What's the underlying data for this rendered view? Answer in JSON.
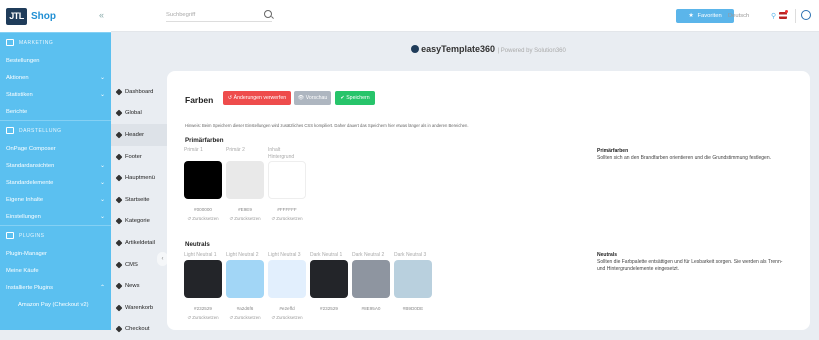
{
  "sidebar": {
    "logo": "JTL",
    "shop": "Shop",
    "collapse": "«",
    "sections": [
      {
        "label": "MARKETING",
        "items": [
          {
            "label": "Bestellungen",
            "caret": ""
          },
          {
            "label": "Aktionen",
            "caret": "⌄"
          },
          {
            "label": "Statistiken",
            "caret": "⌄"
          },
          {
            "label": "Berichte",
            "caret": ""
          }
        ]
      },
      {
        "label": "DARSTELLUNG",
        "items": [
          {
            "label": "OnPage Composer",
            "caret": ""
          },
          {
            "label": "Standardansichten",
            "caret": "⌄"
          },
          {
            "label": "Standardelemente",
            "caret": "⌄"
          },
          {
            "label": "Eigene Inhalte",
            "caret": "⌄"
          },
          {
            "label": "Einstellungen",
            "caret": "⌄"
          }
        ]
      },
      {
        "label": "PLUGINS",
        "items": [
          {
            "label": "Plugin-Manager",
            "caret": ""
          },
          {
            "label": "Meine Käufe",
            "caret": ""
          },
          {
            "label": "Installierte Plugins",
            "caret": "⌃"
          },
          {
            "label": "Amazon Pay (Checkout v2)",
            "caret": ""
          }
        ]
      }
    ]
  },
  "topbar": {
    "search_placeholder": "Suchbegriff",
    "favorites": "Favoriten",
    "language": "Deutsch"
  },
  "subnav": {
    "items": [
      "Dashboard",
      "Global",
      "Header",
      "Footer",
      "Hauptmenü",
      "Startseite",
      "Kategorie",
      "Artikeldetail",
      "CMS",
      "News",
      "Warenkorb",
      "Checkout"
    ],
    "active": 2,
    "toggle": "‹"
  },
  "brand": {
    "name": "easyTemplate360",
    "powered": "Powered by Solution360"
  },
  "card": {
    "title": "Farben",
    "btn_discard": "Änderungen verwerfen",
    "btn_preview": "Vorschau",
    "btn_save": "Speichern",
    "hint": "Hinweis: Beim Speichern dieser Einstellungen wird zusätzliches CSS kompiliert. Daher dauert das Speichern hier etwas länger als in anderen Bereichen.",
    "primary": {
      "title": "Primärfarben",
      "desc_title": "Primärfarben",
      "desc": "Sollten sich an den Brandfarben orientieren und die Grundstimmung festlegen.",
      "swatches": [
        {
          "name": "Primär 1",
          "name2": "",
          "hex": "#000000",
          "reset": "Zurücksetzen"
        },
        {
          "name": "Primär 2",
          "name2": "",
          "hex": "#E9E9",
          "reset": "Zurücksetzen"
        },
        {
          "name": "Inhalt",
          "name2": "Hintergrund",
          "hex": "#FFFFFF",
          "reset": "Zurücksetzen"
        }
      ],
      "colors": [
        "#000000",
        "#e9e9e9",
        "#ffffff"
      ]
    },
    "neutrals": {
      "title": "Neutrals",
      "desc_title": "Neutrals",
      "desc": "Sollten die Farbpalette entsättigen und für Lesbarkeit sorgen. Sie werden als Trenn- und Hintergrundelemente eingesetzt.",
      "swatches": [
        {
          "name": "Light Neutral 1",
          "hex": "#232529",
          "reset": "Zurücksetzen"
        },
        {
          "name": "Light Neutral 2",
          "hex": "#a2d6f6",
          "reset": "Zurücksetzen"
        },
        {
          "name": "Light Neutral 3",
          "hex": "#e2effd",
          "reset": "Zurücksetzen"
        },
        {
          "name": "Dark Neutral 1",
          "hex": "#232529",
          "reset": ""
        },
        {
          "name": "Dark Neutral 2",
          "hex": "#8E95A0",
          "reset": ""
        },
        {
          "name": "Dark Neutral 3",
          "hex": "#B9D0DE",
          "reset": ""
        }
      ],
      "colors": [
        "#232529",
        "#a2d6f6",
        "#e2effd",
        "#232529",
        "#8e95a0",
        "#b9d0de"
      ]
    }
  }
}
